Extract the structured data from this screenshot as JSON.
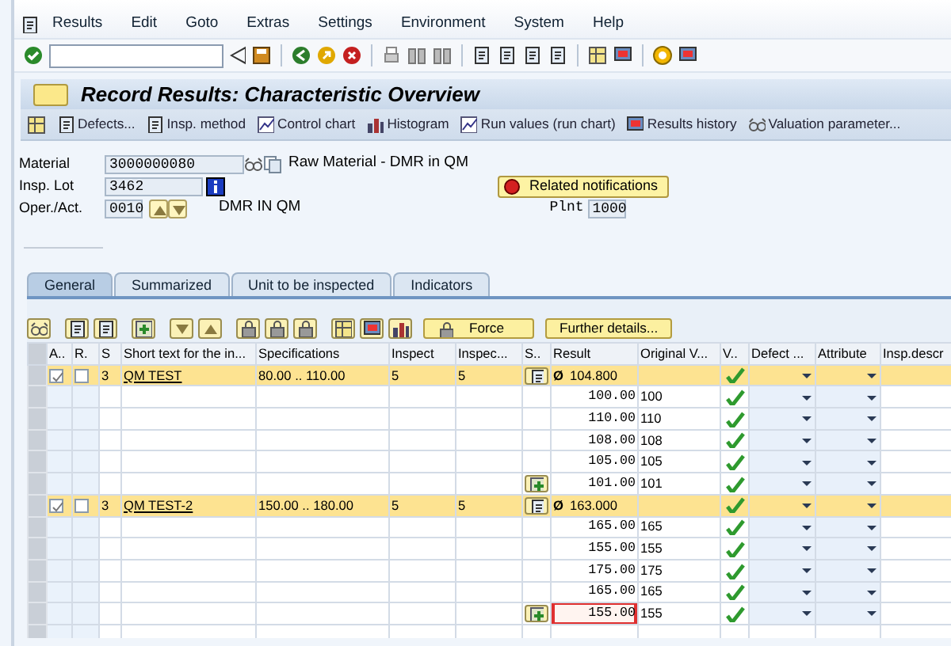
{
  "menu": [
    "Results",
    "Edit",
    "Goto",
    "Extras",
    "Settings",
    "Environment",
    "System",
    "Help"
  ],
  "title": "Record Results: Characteristic Overview",
  "app_toolbar": [
    "Defects...",
    "Insp. method",
    "Control chart",
    "Histogram",
    "Run values (run chart)",
    "Results history",
    "Valuation parameter..."
  ],
  "header": {
    "material": {
      "label": "Material",
      "value": "3000000080",
      "description": "Raw Material - DMR in QM"
    },
    "insp_lot": {
      "label": "Insp. Lot",
      "value": "3462"
    },
    "operation": {
      "label": "Oper./Act.",
      "value": "0010",
      "description": "DMR IN QM"
    },
    "plant": {
      "label": "Plnt",
      "value": "1000"
    },
    "notifications_button": "Related notifications"
  },
  "tabs": [
    {
      "label": "General",
      "selected": true
    },
    {
      "label": "Summarized",
      "selected": false
    },
    {
      "label": "Unit to be inspected",
      "selected": false
    },
    {
      "label": "Indicators",
      "selected": false
    }
  ],
  "table_buttons": [
    "Force",
    "Further details..."
  ],
  "table": {
    "columns": [
      "A..",
      "R.",
      "S",
      "Short text for the in...",
      "Specifications",
      "Inspect",
      "Inspec...",
      "S..",
      "Result",
      "Original V...",
      "V..",
      "Defect ...",
      "Attribute",
      "Insp.descr"
    ],
    "rows": [
      {
        "kind": "characteristic",
        "a_checked": true,
        "r_checked": false,
        "s": "3",
        "short_text": "QM TEST",
        "specifications": "80.00 .. 110.00",
        "inspect": "5",
        "inspected": "5",
        "detail_button": true,
        "add_button": false,
        "mean": "Ø",
        "result": "104.800",
        "original": "",
        "valuation_ok": true
      },
      {
        "kind": "value",
        "detail_button": false,
        "add_button": false,
        "result": "100.00",
        "original": "100",
        "valuation_ok": true,
        "focused": false
      },
      {
        "kind": "value",
        "detail_button": false,
        "add_button": false,
        "result": "110.00",
        "original": "110",
        "valuation_ok": true,
        "focused": false
      },
      {
        "kind": "value",
        "detail_button": false,
        "add_button": false,
        "result": "108.00",
        "original": "108",
        "valuation_ok": true,
        "focused": false
      },
      {
        "kind": "value",
        "detail_button": false,
        "add_button": false,
        "result": "105.00",
        "original": "105",
        "valuation_ok": true,
        "focused": false
      },
      {
        "kind": "value",
        "detail_button": false,
        "add_button": true,
        "result": "101.00",
        "original": "101",
        "valuation_ok": true,
        "focused": false
      },
      {
        "kind": "characteristic",
        "a_checked": true,
        "r_checked": false,
        "s": "3",
        "short_text": "QM TEST-2",
        "specifications": "150.00 .. 180.00",
        "inspect": "5",
        "inspected": "5",
        "detail_button": true,
        "add_button": false,
        "mean": "Ø",
        "result": "163.000",
        "original": "",
        "valuation_ok": true
      },
      {
        "kind": "value",
        "detail_button": false,
        "add_button": false,
        "result": "165.00",
        "original": "165",
        "valuation_ok": true,
        "focused": false
      },
      {
        "kind": "value",
        "detail_button": false,
        "add_button": false,
        "result": "155.00",
        "original": "155",
        "valuation_ok": true,
        "focused": false
      },
      {
        "kind": "value",
        "detail_button": false,
        "add_button": false,
        "result": "175.00",
        "original": "175",
        "valuation_ok": true,
        "focused": false
      },
      {
        "kind": "value",
        "detail_button": false,
        "add_button": false,
        "result": "165.00",
        "original": "165",
        "valuation_ok": true,
        "focused": false
      },
      {
        "kind": "value",
        "detail_button": false,
        "add_button": true,
        "result": "155.00",
        "original": "155",
        "valuation_ok": true,
        "focused": true
      },
      {
        "kind": "empty"
      }
    ]
  }
}
